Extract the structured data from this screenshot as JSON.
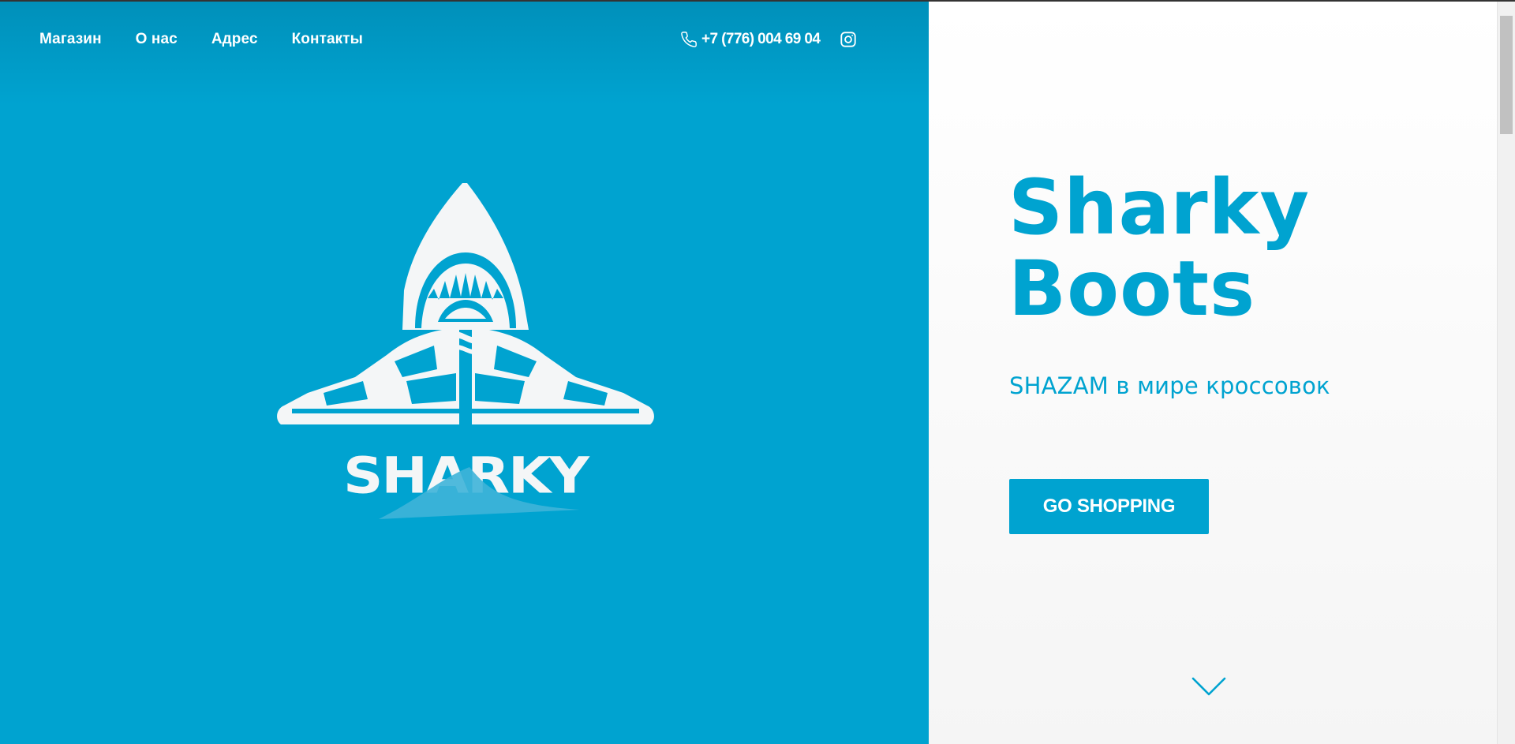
{
  "nav": {
    "items": [
      {
        "label": "Магазин"
      },
      {
        "label": "О нас"
      },
      {
        "label": "Адрес"
      },
      {
        "label": "Контакты"
      }
    ]
  },
  "contacts": {
    "phone": "+7 (776) 004 69 04",
    "phone_icon": "phone-icon",
    "social_icon": "instagram-icon"
  },
  "logo": {
    "text": "SHARKY"
  },
  "hero": {
    "title_line1": "Sharky",
    "title_line2": "Boots",
    "subtitle": "SHAZAM в мире кроссовок",
    "cta_label": "GO SHOPPING",
    "scroll_icon": "chevron-down-icon"
  },
  "colors": {
    "brand": "#00a3d0",
    "background_right": "#f7f7f7",
    "text_on_brand": "#ffffff"
  }
}
